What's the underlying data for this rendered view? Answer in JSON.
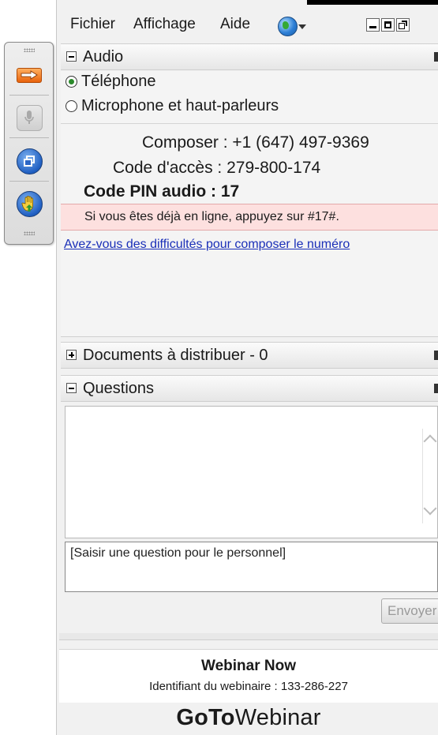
{
  "menu": {
    "file": "Fichier",
    "view": "Affichage",
    "help": "Aide"
  },
  "audio": {
    "title": "Audio",
    "option_phone": "Téléphone",
    "option_mic": "Microphone et haut-parleurs",
    "dial_label": "Composer : +1 (647) 497-9369",
    "access_label": "Code d'accès : 279-800-174",
    "pin_label": "Code PIN audio : 17",
    "notice": "Si vous êtes déjà en ligne, appuyez sur #17#.",
    "help_link": "Avez-vous des difficultés pour composer le numéro"
  },
  "handouts": {
    "title": "Documents à distribuer - 0"
  },
  "questions": {
    "title": "Questions",
    "input_text": "[Saisir une question pour le personnel]",
    "send_label": "Envoyer"
  },
  "footer": {
    "webinar_title": "Webinar Now",
    "webinar_id": "Identifiant du webinaire : 133-286-227",
    "brand_goto": "GoTo",
    "brand_webinar": "Webinar"
  },
  "icons": {
    "grabtab_arrow": "arrow-right-icon",
    "grabtab_mic": "microphone-icon",
    "grabtab_window": "restore-window-icon",
    "grabtab_hand": "raise-hand-icon",
    "language": "globe-icon"
  },
  "colors": {
    "accent_orange": "#e8620c",
    "notice_bg": "#fde0df",
    "link": "#1a2fb8",
    "button_blue": "#1f5fc2"
  }
}
